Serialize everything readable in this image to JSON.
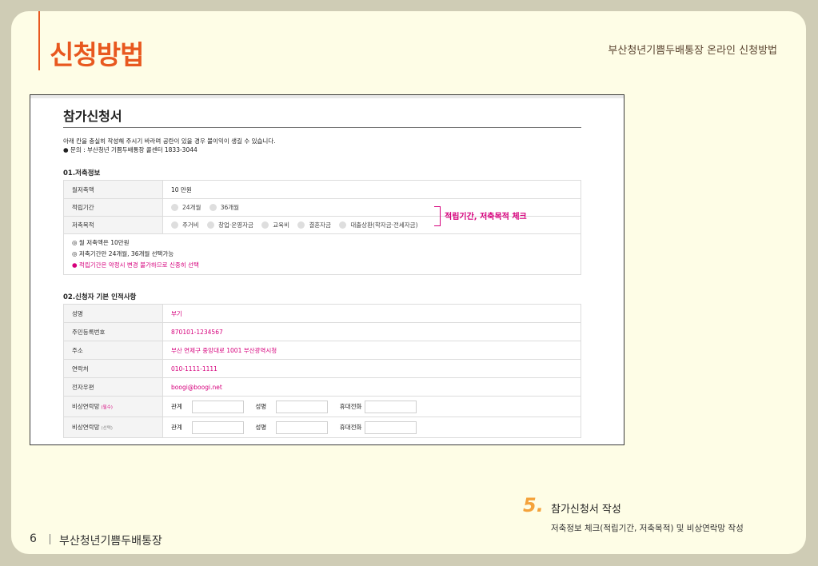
{
  "page": {
    "title": "신청방법",
    "header": "부산청년기쁨두배통장 온라인 신청방법",
    "page_number": "6",
    "footer_title": "부산청년기쁨두배통장"
  },
  "form": {
    "title": "참가신청서",
    "intro1": "아래 칸을 충실히 작성해 주시기 바라며 공란이 있을 경우 불이익이 생길 수 있습니다.",
    "intro2": "● 문의 : 부산청년 기쁨두배통장 콜센터 1833-3044",
    "section1": {
      "title": "01.저축정보",
      "monthly_label": "월저축액",
      "monthly_value": "10 만원",
      "period_label": "적립기간",
      "period_options": [
        "24개월",
        "36개월"
      ],
      "purpose_label": "저축목적",
      "purpose_options": [
        "주거비",
        "창업·운영자금",
        "교육비",
        "결혼자금",
        "대출상환(학자금·전세자금)"
      ],
      "notes": [
        "◎ 월 저축액은 10만원",
        "◎ 저축기간만 24개월, 36개월 선택가능"
      ],
      "warning": "● 적립기간은 약정시 변경 불가하므로 신중히 선택"
    },
    "section2": {
      "title": "02.신청자 기본 인적사항",
      "rows": [
        {
          "label": "성명",
          "value": "부기"
        },
        {
          "label": "주민등록번호",
          "value": "870101-1234567"
        },
        {
          "label": "주소",
          "value": "부산 연제구 중앙대로 1001 부산광역시청"
        },
        {
          "label": "연락처",
          "value": "010-1111-1111"
        },
        {
          "label": "전자우편",
          "value": "boogi@boogi.net"
        }
      ],
      "emergency_required_label": "비상연락망",
      "required_tag": "(필수)",
      "emergency_optional_label": "비상연락망",
      "optional_tag": "(선택)",
      "relation_label": "관계",
      "name_label": "성명",
      "phone_label": "휴대전화"
    }
  },
  "annotation": "적립기간, 저축목적 체크",
  "step": {
    "number": "5.",
    "title": "참가신청서 작성",
    "description": "저축정보 체크(적립기간, 저축목적) 및 비상연락망 작성"
  },
  "colors": {
    "accent_orange": "#e8581f",
    "step_orange": "#f4a23b",
    "highlight_pink": "#d6007c",
    "page_bg": "#fefde6",
    "frame_bg": "#cfccb5"
  }
}
